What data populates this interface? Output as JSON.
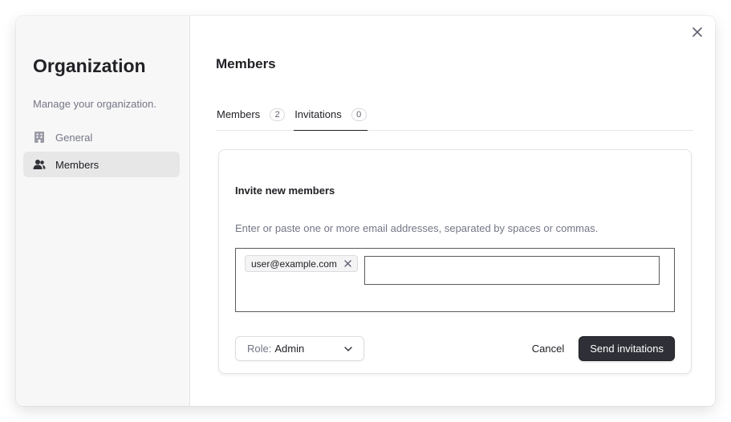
{
  "sidebar": {
    "title": "Organization",
    "subtitle": "Manage your organization.",
    "items": [
      {
        "label": "General",
        "icon": "building-icon",
        "active": false
      },
      {
        "label": "Members",
        "icon": "users-icon",
        "active": true
      }
    ]
  },
  "main": {
    "title": "Members",
    "tabs": [
      {
        "label": "Members",
        "count": "2",
        "active": false
      },
      {
        "label": "Invitations",
        "count": "0",
        "active": true
      }
    ],
    "invite": {
      "title": "Invite new members",
      "description": "Enter or paste one or more email addresses, separated by spaces or commas.",
      "chips": [
        "user@example.com"
      ],
      "input_value": "",
      "role_label": "Role:",
      "role_value": "Admin",
      "cancel_label": "Cancel",
      "send_label": "Send invitations"
    }
  },
  "colors": {
    "primary_button": "#2f3037",
    "sidebar_bg": "#f7f7f7",
    "active_nav_bg": "#e7e7e8",
    "muted_text": "#747686"
  }
}
